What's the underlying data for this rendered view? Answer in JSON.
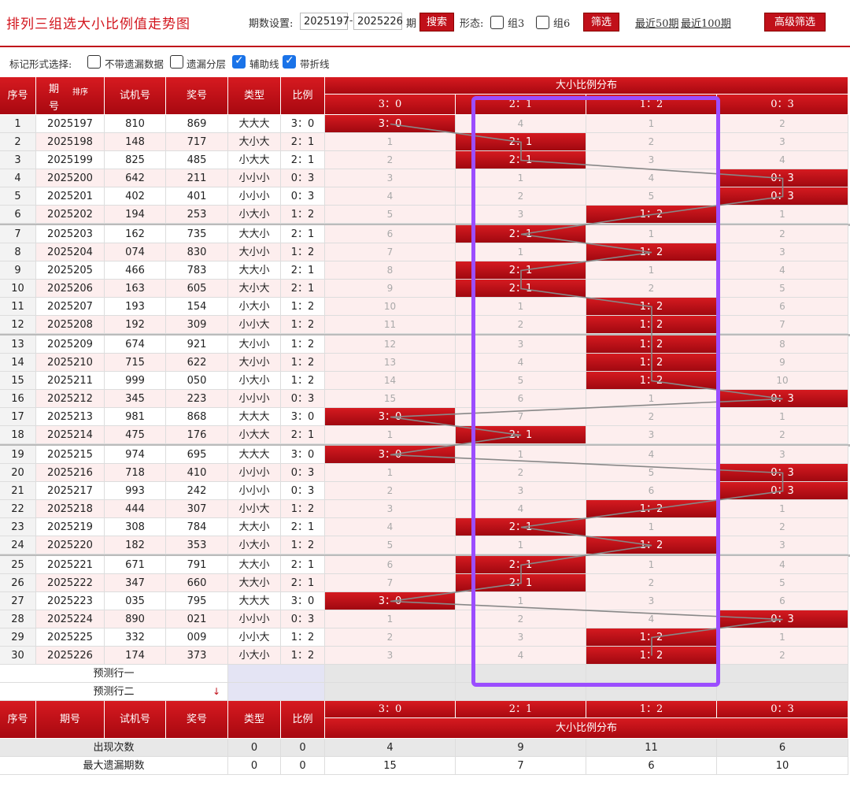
{
  "header": {
    "title": "排列三组选大小比例值走势图",
    "period_label": "期数设置:",
    "period_from": "2025197",
    "period_dash": "-",
    "period_to": "2025226",
    "period_suffix": "期",
    "search_label": "搜索",
    "form_label": "形态:",
    "group3_label": "组3",
    "group6_label": "组6",
    "filter_label": "筛选",
    "recent50_label": "最近50期",
    "recent100_label": "最近100期",
    "advanced_label": "高级筛选"
  },
  "markbar": {
    "label": "标记形式选择:",
    "opt1": "不带遗漏数据",
    "opt2": "遗漏分层",
    "opt3": "辅助线",
    "opt4": "带折线",
    "opt1_checked": false,
    "opt2_checked": false,
    "opt3_checked": true,
    "opt4_checked": true
  },
  "table": {
    "col_seq": "序号",
    "col_period": "期号",
    "col_period_a": "期",
    "col_period_b": "号",
    "sort_label": "排序",
    "col_test": "试机号",
    "col_prize": "奖号",
    "col_type": "类型",
    "col_ratio": "比例",
    "dist_title": "大小比例分布",
    "dist_cols": [
      "3：0",
      "2：1",
      "1：2",
      "0：3"
    ],
    "rows": [
      {
        "seq": "1",
        "period": "2025197",
        "test": "810",
        "prize": "869",
        "type": "大大大",
        "ratio": "3：0",
        "hit": 0,
        "miss": [
          "3：0",
          "4",
          "1",
          "2"
        ]
      },
      {
        "seq": "2",
        "period": "2025198",
        "test": "148",
        "prize": "717",
        "type": "大小大",
        "ratio": "2：1",
        "hit": 1,
        "miss": [
          "1",
          "2：1",
          "2",
          "3"
        ]
      },
      {
        "seq": "3",
        "period": "2025199",
        "test": "825",
        "prize": "485",
        "type": "小大大",
        "ratio": "2：1",
        "hit": 1,
        "miss": [
          "2",
          "2：1",
          "3",
          "4"
        ]
      },
      {
        "seq": "4",
        "period": "2025200",
        "test": "642",
        "prize": "211",
        "type": "小小小",
        "ratio": "0：3",
        "hit": 3,
        "miss": [
          "3",
          "1",
          "4",
          "0：3"
        ]
      },
      {
        "seq": "5",
        "period": "2025201",
        "test": "402",
        "prize": "401",
        "type": "小小小",
        "ratio": "0：3",
        "hit": 3,
        "miss": [
          "4",
          "2",
          "5",
          "0：3"
        ]
      },
      {
        "seq": "6",
        "period": "2025202",
        "test": "194",
        "prize": "253",
        "type": "小大小",
        "ratio": "1：2",
        "hit": 2,
        "miss": [
          "5",
          "3",
          "1：2",
          "1"
        ]
      },
      {
        "seq": "7",
        "period": "2025203",
        "test": "162",
        "prize": "735",
        "type": "大大小",
        "ratio": "2：1",
        "hit": 1,
        "miss": [
          "6",
          "2：1",
          "1",
          "2"
        ]
      },
      {
        "seq": "8",
        "period": "2025204",
        "test": "074",
        "prize": "830",
        "type": "大小小",
        "ratio": "1：2",
        "hit": 2,
        "miss": [
          "7",
          "1",
          "1：2",
          "3"
        ]
      },
      {
        "seq": "9",
        "period": "2025205",
        "test": "466",
        "prize": "783",
        "type": "大大小",
        "ratio": "2：1",
        "hit": 1,
        "miss": [
          "8",
          "2：1",
          "1",
          "4"
        ]
      },
      {
        "seq": "10",
        "period": "2025206",
        "test": "163",
        "prize": "605",
        "type": "大小大",
        "ratio": "2：1",
        "hit": 1,
        "miss": [
          "9",
          "2：1",
          "2",
          "5"
        ]
      },
      {
        "seq": "11",
        "period": "2025207",
        "test": "193",
        "prize": "154",
        "type": "小大小",
        "ratio": "1：2",
        "hit": 2,
        "miss": [
          "10",
          "1",
          "1：2",
          "6"
        ]
      },
      {
        "seq": "12",
        "period": "2025208",
        "test": "192",
        "prize": "309",
        "type": "小小大",
        "ratio": "1：2",
        "hit": 2,
        "miss": [
          "11",
          "2",
          "1：2",
          "7"
        ]
      },
      {
        "seq": "13",
        "period": "2025209",
        "test": "674",
        "prize": "921",
        "type": "大小小",
        "ratio": "1：2",
        "hit": 2,
        "miss": [
          "12",
          "3",
          "1：2",
          "8"
        ]
      },
      {
        "seq": "14",
        "period": "2025210",
        "test": "715",
        "prize": "622",
        "type": "大小小",
        "ratio": "1：2",
        "hit": 2,
        "miss": [
          "13",
          "4",
          "1：2",
          "9"
        ]
      },
      {
        "seq": "15",
        "period": "2025211",
        "test": "999",
        "prize": "050",
        "type": "小大小",
        "ratio": "1：2",
        "hit": 2,
        "miss": [
          "14",
          "5",
          "1：2",
          "10"
        ]
      },
      {
        "seq": "16",
        "period": "2025212",
        "test": "345",
        "prize": "223",
        "type": "小小小",
        "ratio": "0：3",
        "hit": 3,
        "miss": [
          "15",
          "6",
          "1",
          "0：3"
        ]
      },
      {
        "seq": "17",
        "period": "2025213",
        "test": "981",
        "prize": "868",
        "type": "大大大",
        "ratio": "3：0",
        "hit": 0,
        "miss": [
          "3：0",
          "7",
          "2",
          "1"
        ]
      },
      {
        "seq": "18",
        "period": "2025214",
        "test": "475",
        "prize": "176",
        "type": "小大大",
        "ratio": "2：1",
        "hit": 1,
        "miss": [
          "1",
          "2：1",
          "3",
          "2"
        ]
      },
      {
        "seq": "19",
        "period": "2025215",
        "test": "974",
        "prize": "695",
        "type": "大大大",
        "ratio": "3：0",
        "hit": 0,
        "miss": [
          "3：0",
          "1",
          "4",
          "3"
        ]
      },
      {
        "seq": "20",
        "period": "2025216",
        "test": "718",
        "prize": "410",
        "type": "小小小",
        "ratio": "0：3",
        "hit": 3,
        "miss": [
          "1",
          "2",
          "5",
          "0：3"
        ]
      },
      {
        "seq": "21",
        "period": "2025217",
        "test": "993",
        "prize": "242",
        "type": "小小小",
        "ratio": "0：3",
        "hit": 3,
        "miss": [
          "2",
          "3",
          "6",
          "0：3"
        ]
      },
      {
        "seq": "22",
        "period": "2025218",
        "test": "444",
        "prize": "307",
        "type": "小小大",
        "ratio": "1：2",
        "hit": 2,
        "miss": [
          "3",
          "4",
          "1：2",
          "1"
        ]
      },
      {
        "seq": "23",
        "period": "2025219",
        "test": "308",
        "prize": "784",
        "type": "大大小",
        "ratio": "2：1",
        "hit": 1,
        "miss": [
          "4",
          "2：1",
          "1",
          "2"
        ]
      },
      {
        "seq": "24",
        "period": "2025220",
        "test": "182",
        "prize": "353",
        "type": "小大小",
        "ratio": "1：2",
        "hit": 2,
        "miss": [
          "5",
          "1",
          "1：2",
          "3"
        ]
      },
      {
        "seq": "25",
        "period": "2025221",
        "test": "671",
        "prize": "791",
        "type": "大大小",
        "ratio": "2：1",
        "hit": 1,
        "miss": [
          "6",
          "2：1",
          "1",
          "4"
        ]
      },
      {
        "seq": "26",
        "period": "2025222",
        "test": "347",
        "prize": "660",
        "type": "大大小",
        "ratio": "2：1",
        "hit": 1,
        "miss": [
          "7",
          "2：1",
          "2",
          "5"
        ]
      },
      {
        "seq": "27",
        "period": "2025223",
        "test": "035",
        "prize": "795",
        "type": "大大大",
        "ratio": "3：0",
        "hit": 0,
        "miss": [
          "3：0",
          "1",
          "3",
          "6"
        ]
      },
      {
        "seq": "28",
        "period": "2025224",
        "test": "890",
        "prize": "021",
        "type": "小小小",
        "ratio": "0：3",
        "hit": 3,
        "miss": [
          "1",
          "2",
          "4",
          "0：3"
        ]
      },
      {
        "seq": "29",
        "period": "2025225",
        "test": "332",
        "prize": "009",
        "type": "小小大",
        "ratio": "1：2",
        "hit": 2,
        "miss": [
          "2",
          "3",
          "1：2",
          "1"
        ]
      },
      {
        "seq": "30",
        "period": "2025226",
        "test": "174",
        "prize": "373",
        "type": "小大小",
        "ratio": "1：2",
        "hit": 2,
        "miss": [
          "3",
          "4",
          "1：2",
          "2"
        ]
      }
    ],
    "predict1": "预测行一",
    "predict2": "预测行二",
    "stats_appear_label": "出现次数",
    "stats_appear": [
      "0",
      "0",
      "4",
      "9",
      "11",
      "6"
    ],
    "stats_maxmiss_label": "最大遗漏期数",
    "stats_maxmiss": [
      "0",
      "0",
      "15",
      "7",
      "6",
      "10"
    ]
  },
  "colors": {
    "brand_red": "#c0101a",
    "highlight_box": "#9b4dff",
    "row_even": "#fdeeee"
  }
}
